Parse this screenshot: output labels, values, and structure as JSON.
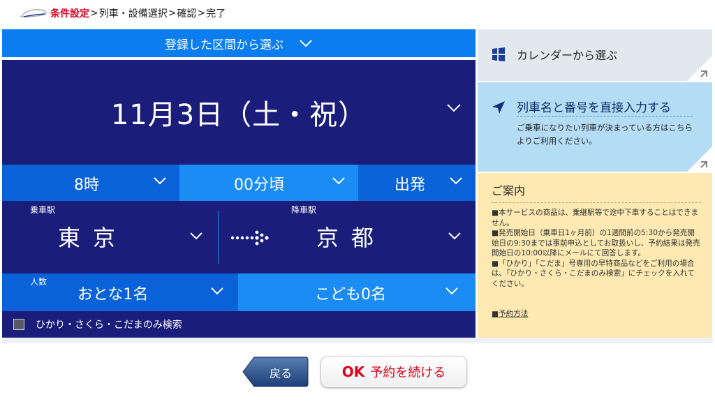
{
  "breadcrumb": {
    "steps": [
      "条件設定",
      "列車・設備選択",
      "確認",
      "完了"
    ],
    "separator": ">"
  },
  "main": {
    "registered_label": "登録した区間から選ぶ",
    "date": "11月3日（土・祝）",
    "hour": "8時",
    "minute": "00分頃",
    "departure_mode": "出発",
    "from_caption": "乗車駅",
    "from_station": "東京",
    "to_caption": "降車駅",
    "to_station": "京都",
    "people_caption": "人数",
    "adults": "おとな1名",
    "children": "こども0名",
    "checkbox_label": "ひかり・さくら・こだまのみ検索"
  },
  "side": {
    "calendar_label": "カレンダーから選ぶ",
    "train_title": "列車名と番号を直接入力する",
    "train_desc": "ご乗車になりたい列車が決まっている方はこちらよりご利用ください。",
    "info_title": "ご案内",
    "notes": [
      "■本サービスの商品は、乗継駅等で途中下車することはできません。",
      "■発売開始日（乗車日1ヶ月前）の1週間前の5:30から発売開始日の9:30までは事前申込としてお取扱いし、予約結果は発売開始日の10:00以降にメールにて回答します。",
      "■「ひかり」「こだま」号専用の早特商品などをご利用の場合は、「ひかり・さくら・こだまのみ検索」にチェックを入れてください。"
    ],
    "link": "■予約方法"
  },
  "buttons": {
    "back": "戻る",
    "ok_mark": "OK",
    "continue": "予約を続ける"
  },
  "colors": {
    "navy": "#1a1d7a",
    "blue": "#0a62d9",
    "light_blue": "#1a8cf4",
    "accent_red": "#e0001b",
    "info_bg": "#fde9b1"
  }
}
